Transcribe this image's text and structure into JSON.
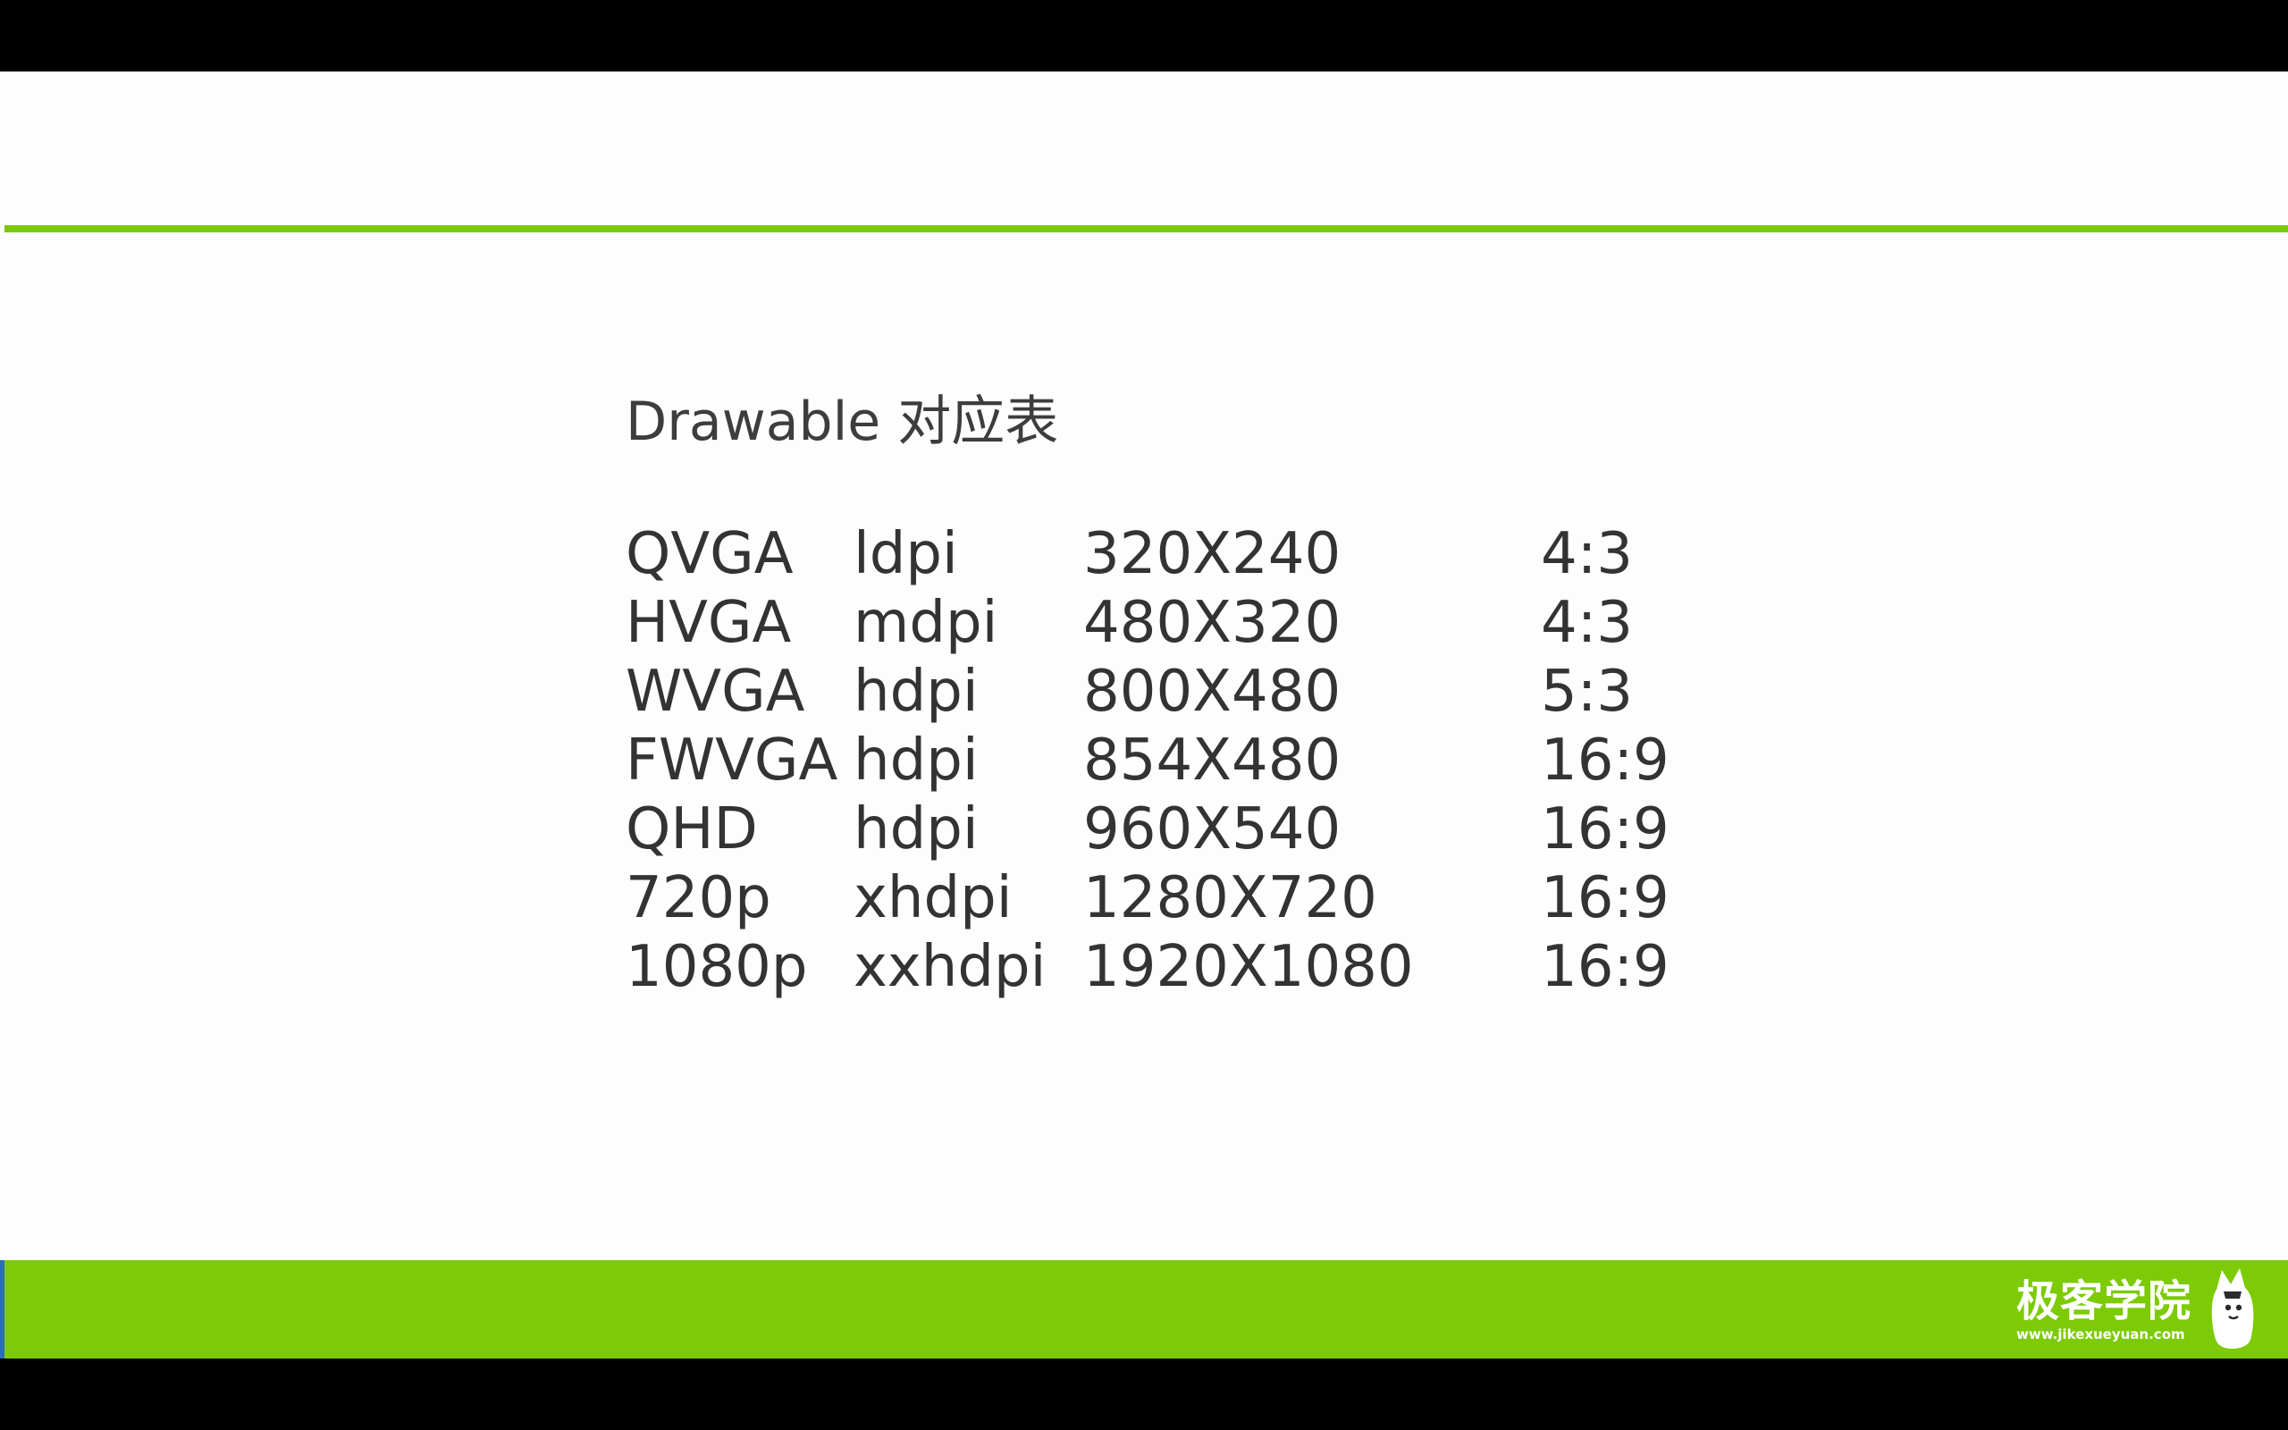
{
  "slide": {
    "title": "Drawable 对应表",
    "rows": [
      {
        "name": "QVGA",
        "dpi": "ldpi",
        "resolution": "320X240",
        "ratio": "4:3"
      },
      {
        "name": "HVGA",
        "dpi": "mdpi",
        "resolution": "480X320",
        "ratio": "4:3"
      },
      {
        "name": "WVGA",
        "dpi": "hdpi",
        "resolution": "800X480",
        "ratio": "5:3"
      },
      {
        "name": "FWVGA",
        "dpi": "hdpi",
        "resolution": "854X480",
        "ratio": "16:9"
      },
      {
        "name": "QHD",
        "dpi": "hdpi",
        "resolution": "960X540",
        "ratio": "16:9"
      },
      {
        "name": "720p",
        "dpi": "xhdpi",
        "resolution": "1280X720",
        "ratio": "16:9"
      },
      {
        "name": "1080p",
        "dpi": "xxhdpi",
        "resolution": "1920X1080",
        "ratio": "16:9"
      }
    ]
  },
  "footer": {
    "brand_name": "极客学院",
    "brand_url": "www.jikexueyuan.com",
    "logo_icon": "jikexueyuan-mascot-icon"
  },
  "colors": {
    "accent": "#7cc80a",
    "background": "#fdfdfd",
    "text": "#333333"
  }
}
